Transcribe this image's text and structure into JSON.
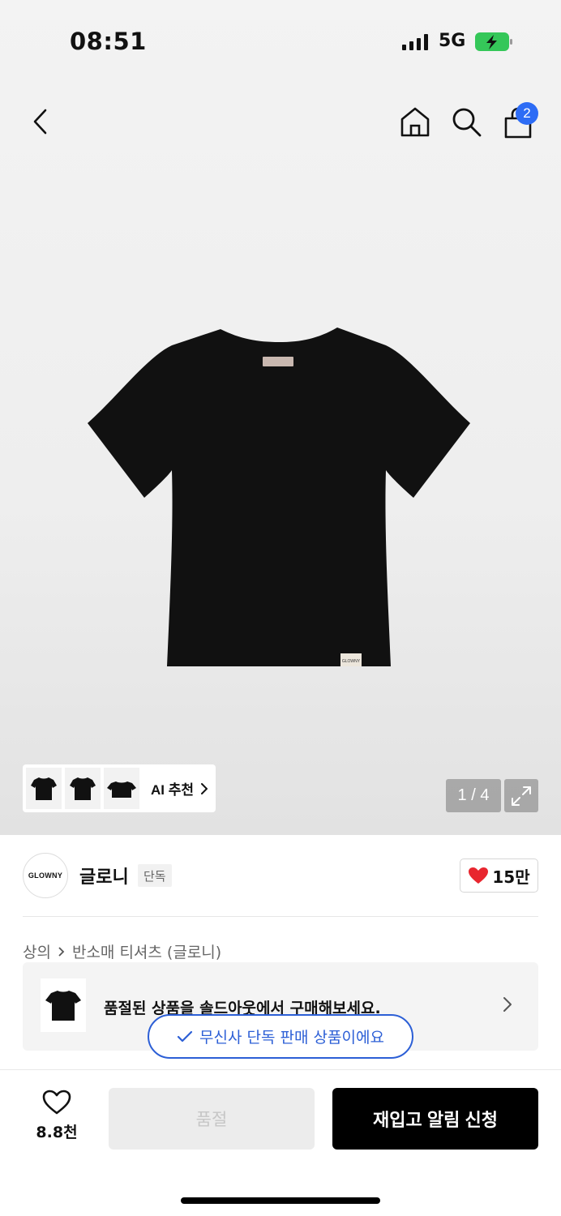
{
  "status_bar": {
    "time": "08:51",
    "network": "5G",
    "icons": [
      "signal-icon",
      "battery-charging-icon"
    ]
  },
  "nav": {
    "icons": [
      "back-icon",
      "home-icon",
      "search-icon",
      "cart-icon"
    ],
    "cart_count": "2"
  },
  "gallery": {
    "ai_label": "AI 추천",
    "page_indicator": "1 / 4",
    "current_page": 1,
    "total_pages": 4
  },
  "brand": {
    "logo_text": "GLOWNY",
    "name": "글로니",
    "tag": "단독",
    "likes": "15만"
  },
  "breadcrumb": {
    "category": "상의",
    "subcategory": "반소매 티셔츠 (글로니)"
  },
  "soldout_banner": {
    "text": "품절된 상품을 솔드아웃에서 구매해보세요."
  },
  "toast": {
    "text": "무신사 단독 판매 상품이에요"
  },
  "bottom_bar": {
    "wish_count": "8.8천",
    "soldout_label": "품절",
    "restock_label": "재입고 알림 신청"
  },
  "colors": {
    "accent_blue": "#2c5fd6",
    "heart_red": "#e8262f",
    "badge_blue": "#2d6cf5",
    "battery_green": "#35c759"
  }
}
